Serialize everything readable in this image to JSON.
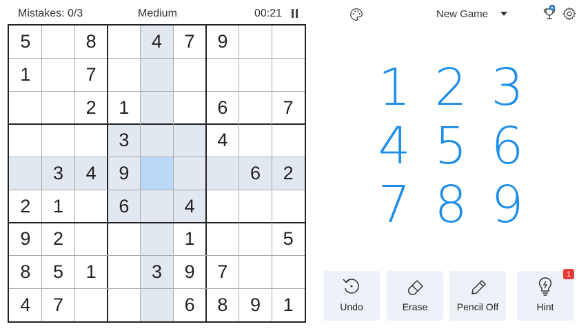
{
  "header": {
    "mistakes": "Mistakes: 0/3",
    "difficulty": "Medium",
    "timer": "00:21",
    "new_game_label": "New Game"
  },
  "icons": {
    "pause": "pause-icon",
    "palette": "palette-icon",
    "dropdown": "chevron-down-icon",
    "trophy": "trophy-icon",
    "settings": "gear-icon"
  },
  "colors": {
    "accent": "#1e8ee9",
    "highlight": "#e2e8f0",
    "selected": "#bcd8f9",
    "badge": "#e53935",
    "tool_bg": "#eef1f7"
  },
  "board": {
    "selected_cell": {
      "row": 5,
      "col": 5
    },
    "rows": [
      [
        "5",
        "",
        "8",
        "",
        "4",
        "7",
        "9",
        "",
        ""
      ],
      [
        "1",
        "",
        "7",
        "",
        "",
        "",
        "",
        "",
        ""
      ],
      [
        "",
        "",
        "2",
        "1",
        "",
        "",
        "6",
        "",
        "7"
      ],
      [
        "",
        "",
        "",
        "3",
        "",
        "",
        "4",
        "",
        ""
      ],
      [
        "",
        "3",
        "4",
        "9",
        "",
        "",
        "",
        "6",
        "2"
      ],
      [
        "2",
        "1",
        "",
        "6",
        "",
        "4",
        "",
        "",
        ""
      ],
      [
        "9",
        "2",
        "",
        "",
        "",
        "1",
        "",
        "",
        "5"
      ],
      [
        "8",
        "5",
        "1",
        "",
        "3",
        "9",
        "7",
        "",
        ""
      ],
      [
        "4",
        "7",
        "",
        "",
        "",
        "6",
        "8",
        "9",
        "1"
      ]
    ]
  },
  "numpad": [
    "1",
    "2",
    "3",
    "4",
    "5",
    "6",
    "7",
    "8",
    "9"
  ],
  "tools": [
    {
      "label": "Undo",
      "icon": "undo-icon"
    },
    {
      "label": "Erase",
      "icon": "eraser-icon"
    },
    {
      "label": "Pencil Off",
      "icon": "pencil-icon"
    },
    {
      "label": "Hint",
      "icon": "lightbulb-icon"
    }
  ],
  "hint_badge": "1"
}
